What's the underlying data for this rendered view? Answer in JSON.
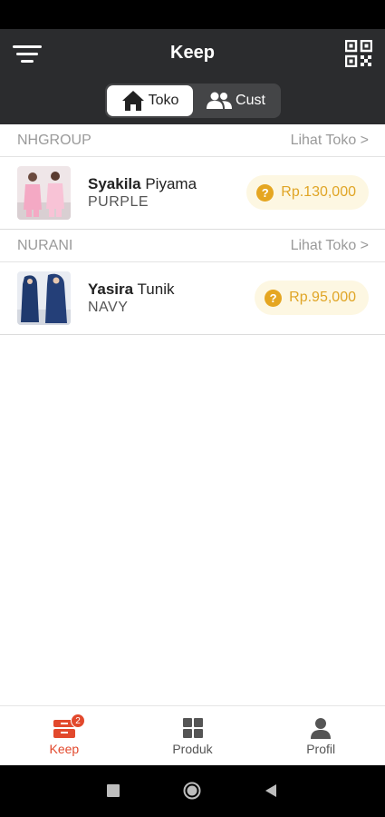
{
  "header": {
    "title": "Keep",
    "menu_icon": "filter-menu-icon",
    "qr_icon": "qr-code-icon"
  },
  "segmented": {
    "toko_label": "Toko",
    "cust_label": "Cust",
    "toko_icon": "home-icon",
    "cust_icon": "users-icon",
    "active": "Toko"
  },
  "groups": [
    {
      "store_name": "NHGROUP",
      "see_store_label": "Lihat Toko >",
      "product": {
        "name_bold": "Syakila",
        "name_rest": " Piyama",
        "variant": "PURPLE",
        "price": "Rp.130,000"
      }
    },
    {
      "store_name": "NURANI",
      "see_store_label": "Lihat Toko >",
      "product": {
        "name_bold": "Yasira",
        "name_rest": " Tunik",
        "variant": "NAVY",
        "price": "Rp.95,000"
      }
    }
  ],
  "bottom_nav": {
    "items": [
      {
        "label": "Keep",
        "icon": "keep-box-icon",
        "badge": "2",
        "active": true
      },
      {
        "label": "Produk",
        "icon": "grid-icon",
        "active": false
      },
      {
        "label": "Profil",
        "icon": "person-icon",
        "active": false
      }
    ]
  },
  "colors": {
    "header_bg": "#2b2c2e",
    "accent": "#e2492d",
    "price_text": "#e0a526",
    "price_bg": "#fdf7e2"
  }
}
